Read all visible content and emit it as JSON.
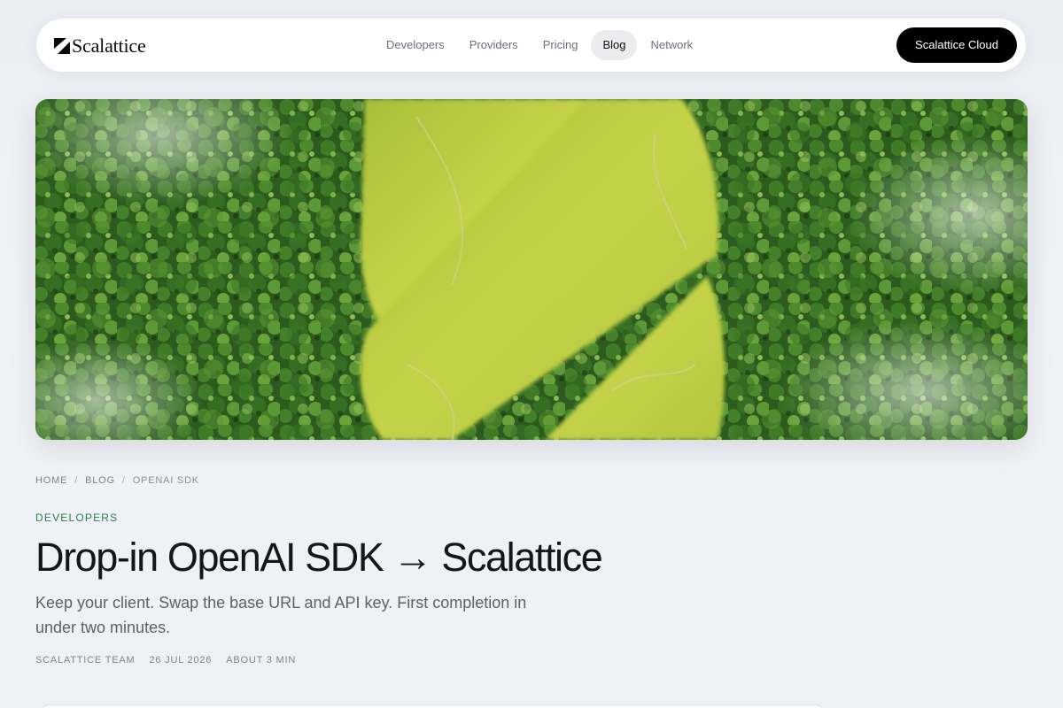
{
  "header": {
    "brand": "Scalattice",
    "nav": [
      {
        "label": "Developers"
      },
      {
        "label": "Providers"
      },
      {
        "label": "Pricing"
      },
      {
        "label": "Blog",
        "active": true
      },
      {
        "label": "Network"
      }
    ],
    "cta_label": "Scalattice Cloud"
  },
  "breadcrumb": {
    "home": "HOME",
    "blog": "BLOG",
    "current": "OPENAI SDK",
    "separator": "/"
  },
  "article": {
    "category": "DEVELOPERS",
    "title": "Drop-in OpenAI SDK → Scalattice",
    "lede": "Keep your client. Swap the base URL and API key. First completion in under two minutes.",
    "author": "SCALATTICE TEAM",
    "date": "26 JUL 2026",
    "read_time": "ABOUT 3 MIN"
  },
  "colors": {
    "accent": "#2f7a4e",
    "cta_bg": "#000000",
    "forest": "#2c5a1d",
    "meadow": "#b6c83d"
  }
}
